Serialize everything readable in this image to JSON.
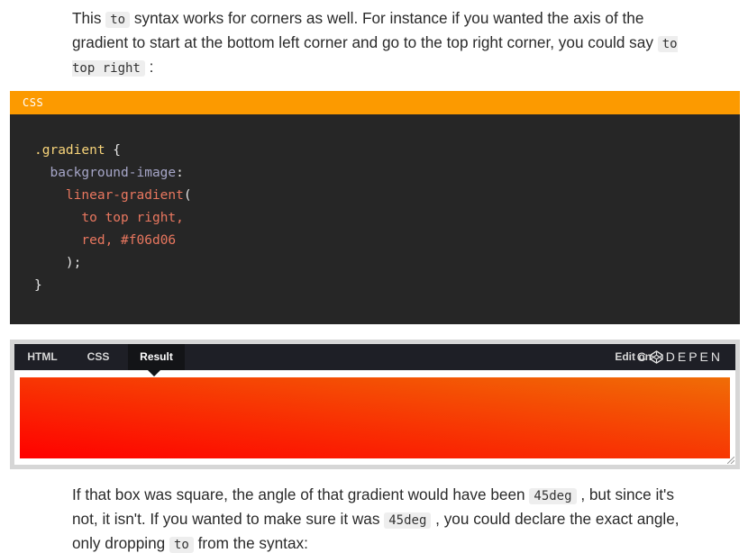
{
  "paragraph_top": {
    "text_1": "This ",
    "code_1": "to",
    "text_2": " syntax works for corners as well. For instance if you wanted the axis of the gradient to start at the bottom left corner and go to the top right corner, you could say ",
    "code_2": "to top right",
    "text_3": " :"
  },
  "code_block": {
    "language": "CSS",
    "lines": {
      "l1_selector": ".gradient",
      "l1_brace": " {",
      "l2_property": "background-image",
      "l2_colon": ":",
      "l3_function": "linear-gradient",
      "l3_paren": "(",
      "l4_value": "to top right,",
      "l5_value": "red, #f06d06",
      "l6_close": ");",
      "l7_close": "}"
    }
  },
  "pen_embed": {
    "tabs": [
      "HTML",
      "CSS",
      "Result"
    ],
    "active_tab": "Result",
    "edit_on_label": "Edit on",
    "codepen_label": "DEPEN",
    "gradient": {
      "direction": "to top right",
      "start_color": "#ff0000",
      "end_color": "#f06d06"
    }
  },
  "paragraph_bottom": {
    "text_1": "If that box was square, the angle of that gradient would have been ",
    "code_1": "45deg",
    "text_2": " , but since it's not, it isn't. If you wanted to make sure it was ",
    "code_2": "45deg",
    "text_3": " , you could declare the exact angle, only dropping ",
    "code_3": "to",
    "text_4": " from the syntax:"
  },
  "colors": {
    "code_header": "#fc9a00",
    "code_background": "#262626",
    "pen_bar": "#1e1f26"
  }
}
